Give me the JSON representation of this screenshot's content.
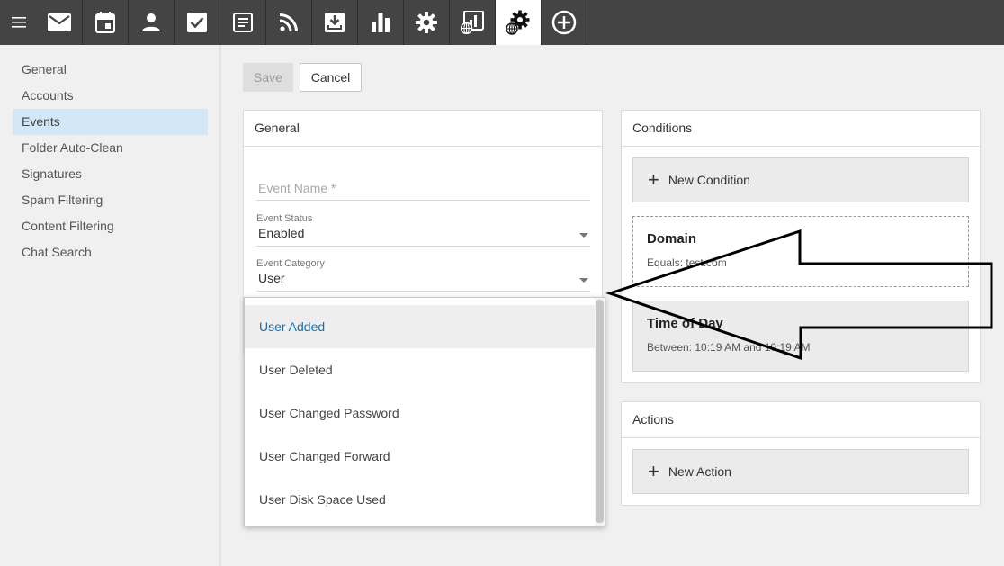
{
  "toolbar": {
    "icons": [
      "menu-icon",
      "mail-icon",
      "calendar-icon",
      "contacts-icon",
      "tasks-icon",
      "notes-icon",
      "rss-icon",
      "download-icon",
      "reports-icon",
      "settings-icon",
      "domain-reports-icon",
      "domain-settings-icon",
      "add-icon"
    ],
    "active": "domain-settings-icon",
    "bg": "#444444"
  },
  "sidebar": {
    "items": [
      "General",
      "Accounts",
      "Events",
      "Folder Auto-Clean",
      "Signatures",
      "Spam Filtering",
      "Content Filtering",
      "Chat Search"
    ],
    "selected": "Events",
    "selected_color": "#d3e7f6"
  },
  "actions_bar": {
    "save_label": "Save",
    "cancel_label": "Cancel"
  },
  "general": {
    "title": "General",
    "event_name_placeholder": "Event Name *",
    "status_label": "Event Status",
    "status_value": "Enabled",
    "category_label": "Event Category",
    "category_value": "User"
  },
  "category_options": [
    "User Added",
    "User Deleted",
    "User Changed Password",
    "User Changed Forward",
    "User Disk Space Used"
  ],
  "conditions": {
    "title": "Conditions",
    "new_label": "New Condition",
    "items": [
      {
        "title": "Domain",
        "desc": "Equals: test.com"
      },
      {
        "title": "Time of Day",
        "desc": "Between: 10:19 AM and 10:19 AM"
      }
    ]
  },
  "actions": {
    "title": "Actions",
    "new_label": "New Action"
  },
  "accent": "#1a6ea8"
}
